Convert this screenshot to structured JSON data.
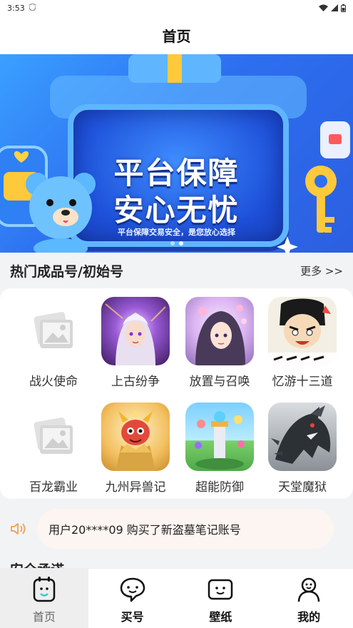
{
  "status_bar": {
    "time": "3:53"
  },
  "header": {
    "title": "首页"
  },
  "banner": {
    "title_line1": "平台保障",
    "title_line2": "安心无忧",
    "subtitle": "平台保障交易安全，是您放心选择",
    "page_count": 2,
    "active_page": 2
  },
  "hot_section": {
    "title": "热门成品号/初始号",
    "more": "更多 >>"
  },
  "games": [
    {
      "name": "战火使命",
      "icon": "image-placeholder-icon"
    },
    {
      "name": "上古纷争",
      "icon": "game-icon-ancient-strife"
    },
    {
      "name": "放置与召唤",
      "icon": "game-icon-idle-summon"
    },
    {
      "name": "忆游十三道",
      "icon": "game-icon-thirteen-paths"
    },
    {
      "name": "百龙霸业",
      "icon": "image-placeholder-icon"
    },
    {
      "name": "九州异兽记",
      "icon": "game-icon-kyushu-beasts"
    },
    {
      "name": "超能防御",
      "icon": "game-icon-super-defense"
    },
    {
      "name": "天堂魔狱",
      "icon": "game-icon-heaven-hell"
    }
  ],
  "notice": {
    "text": "用户20****09 购买了新盗墓笔记账号",
    "icon": "speaker-icon"
  },
  "safety": {
    "title": "安全承诺"
  },
  "tabs": [
    {
      "label": "首页",
      "icon": "home-icon",
      "active": true
    },
    {
      "label": "买号",
      "icon": "chat-icon",
      "active": false
    },
    {
      "label": "壁纸",
      "icon": "wallpaper-icon",
      "active": false
    },
    {
      "label": "我的",
      "icon": "profile-icon",
      "active": false
    }
  ],
  "colors": {
    "accent": "#2d6ff0",
    "notice_bg": "#fdf5f1",
    "speaker": "#f0a050"
  }
}
